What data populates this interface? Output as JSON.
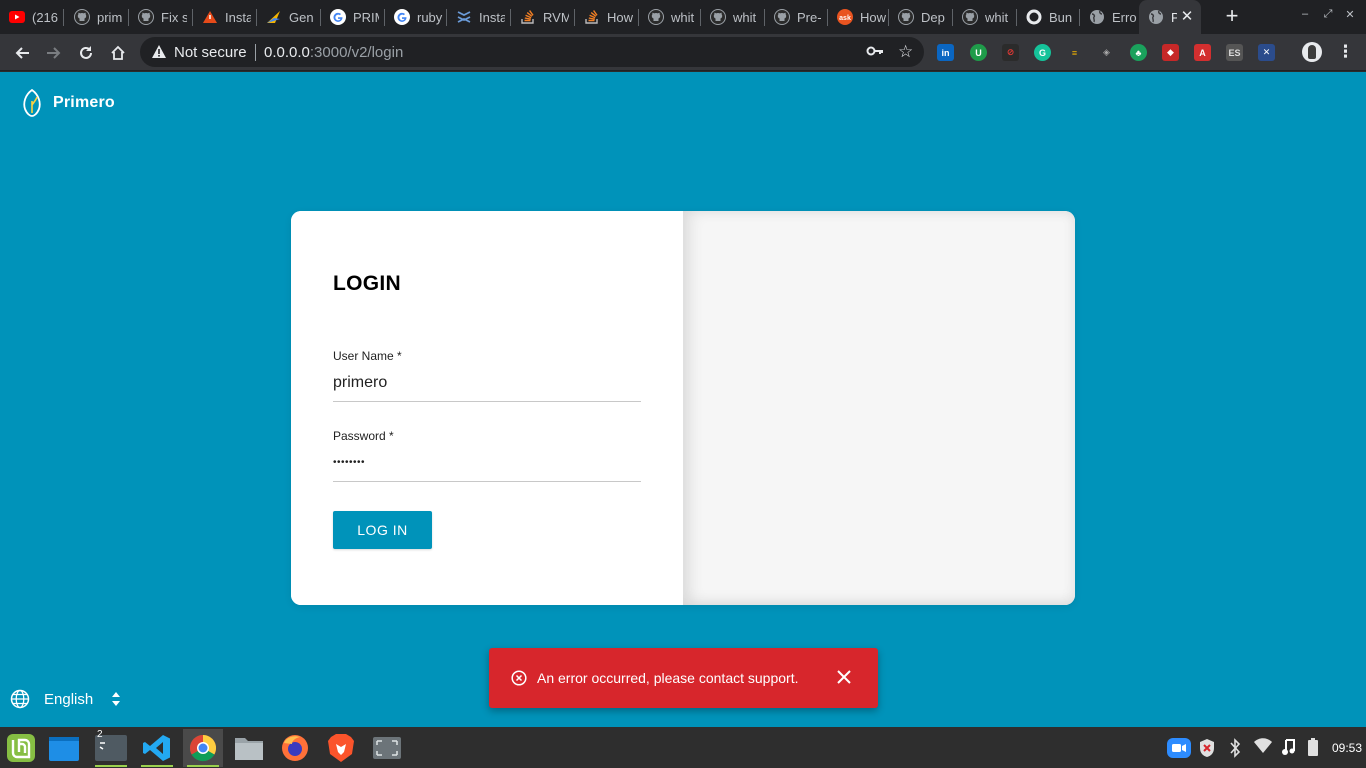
{
  "browser": {
    "tabs": [
      {
        "title": "(216",
        "icon": "youtube-icon"
      },
      {
        "title": "prim",
        "icon": "github-icon"
      },
      {
        "title": "Fix s",
        "icon": "github-icon"
      },
      {
        "title": "Insta",
        "icon": "warning-triangle-icon"
      },
      {
        "title": "Gen",
        "icon": "generator-icon"
      },
      {
        "title": "PRIM",
        "icon": "google-icon"
      },
      {
        "title": "ruby",
        "icon": "google-icon"
      },
      {
        "title": "Insta",
        "icon": "stack-icon"
      },
      {
        "title": "RVM",
        "icon": "stackoverflow-icon"
      },
      {
        "title": "How",
        "icon": "stackoverflow-icon"
      },
      {
        "title": "whit",
        "icon": "github-icon"
      },
      {
        "title": "whit",
        "icon": "github-icon"
      },
      {
        "title": "Pre-",
        "icon": "github-icon"
      },
      {
        "title": "How",
        "icon": "askubuntu-icon"
      },
      {
        "title": "Dep",
        "icon": "github-icon"
      },
      {
        "title": "whit",
        "icon": "github-icon"
      },
      {
        "title": "Bun",
        "icon": "circle-icon"
      },
      {
        "title": "Erro",
        "icon": "globe-icon"
      },
      {
        "title": "P",
        "icon": "globe-icon"
      }
    ],
    "security_label": "Not secure",
    "url_host": "0.0.0.0",
    "url_rest": ":3000/v2/login",
    "extensions": [
      "in",
      "U",
      "⊘",
      "G",
      "≡",
      "◈",
      "♣",
      "◆",
      "A",
      "ES",
      "✕"
    ]
  },
  "app": {
    "brand": "Primero",
    "login": {
      "title": "LOGIN",
      "username_label": "User Name",
      "username_required": "*",
      "username_value": "primero",
      "password_label": "Password",
      "password_required": "*",
      "password_value": "••••••••",
      "submit_label": "LOG IN"
    },
    "snackbar": {
      "message": "An error occurred, please contact support."
    },
    "language": "English"
  },
  "colors": {
    "primary": "#0093ba",
    "error": "#d7262c"
  },
  "taskbar": {
    "apps": [
      "mint-menu-icon",
      "show-desktop-icon",
      "terminal-icon",
      "vscode-icon",
      "chrome-icon",
      "files-icon",
      "firefox-icon",
      "brave-icon",
      "screenshot-icon"
    ],
    "terminal_badge": "2",
    "clock": "09:53"
  }
}
